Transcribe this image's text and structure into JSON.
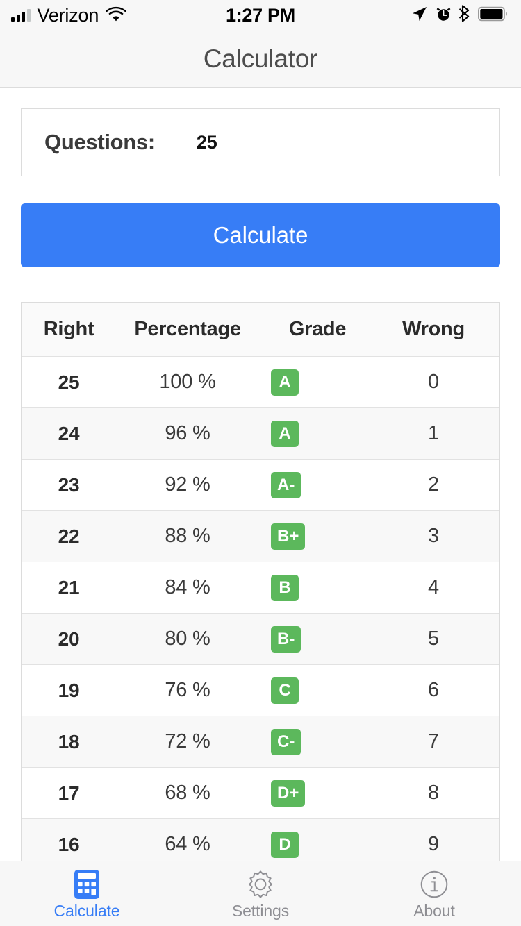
{
  "status_bar": {
    "carrier": "Verizon",
    "time": "1:27 PM",
    "signal_icon": "signal-bars-icon",
    "wifi_icon": "wifi-icon",
    "location_icon": "location-arrow-icon",
    "alarm_icon": "alarm-clock-icon",
    "bluetooth_icon": "bluetooth-icon",
    "battery_icon": "battery-full-icon"
  },
  "nav": {
    "title": "Calculator"
  },
  "questions": {
    "label": "Questions:",
    "value": "25"
  },
  "actions": {
    "calculate_label": "Calculate"
  },
  "colors": {
    "accent_blue": "#377df6",
    "grade_green": "#5cb85c",
    "chrome_gray": "#f7f7f7",
    "tab_inactive": "#8e8e93",
    "row_stripe": "#f8f8f8"
  },
  "table": {
    "headers": [
      "Right",
      "Percentage",
      "Grade",
      "Wrong"
    ],
    "rows": [
      {
        "right": "25",
        "percentage": "100 %",
        "grade": "A",
        "wrong": "0"
      },
      {
        "right": "24",
        "percentage": "96 %",
        "grade": "A",
        "wrong": "1"
      },
      {
        "right": "23",
        "percentage": "92 %",
        "grade": "A-",
        "wrong": "2"
      },
      {
        "right": "22",
        "percentage": "88 %",
        "grade": "B+",
        "wrong": "3"
      },
      {
        "right": "21",
        "percentage": "84 %",
        "grade": "B",
        "wrong": "4"
      },
      {
        "right": "20",
        "percentage": "80 %",
        "grade": "B-",
        "wrong": "5"
      },
      {
        "right": "19",
        "percentage": "76 %",
        "grade": "C",
        "wrong": "6"
      },
      {
        "right": "18",
        "percentage": "72 %",
        "grade": "C-",
        "wrong": "7"
      },
      {
        "right": "17",
        "percentage": "68 %",
        "grade": "D+",
        "wrong": "8"
      },
      {
        "right": "16",
        "percentage": "64 %",
        "grade": "D",
        "wrong": "9"
      }
    ]
  },
  "tab_bar": {
    "items": [
      {
        "label": "Calculate",
        "icon": "calculator-icon",
        "active": true
      },
      {
        "label": "Settings",
        "icon": "gear-icon",
        "active": false
      },
      {
        "label": "About",
        "icon": "info-circle-icon",
        "active": false
      }
    ]
  }
}
